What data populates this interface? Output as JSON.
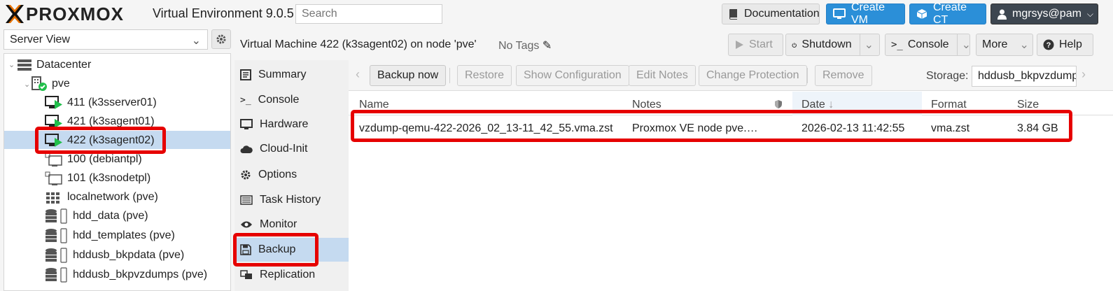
{
  "app": {
    "logo_text": "PROXMOX",
    "title": "Virtual Environment 9.0.5"
  },
  "search": {
    "placeholder": "Search"
  },
  "topbar": {
    "documentation": "Documentation",
    "create_vm": "Create VM",
    "create_ct": "Create CT",
    "user": "mgrsys@pam"
  },
  "server_view": {
    "selected": "Server View"
  },
  "tree": {
    "datacenter": "Datacenter",
    "node": "pve",
    "items": [
      {
        "label": "411 (k3sserver01)",
        "icon": "vm-running-icon"
      },
      {
        "label": "421 (k3sagent01)",
        "icon": "vm-running-icon"
      },
      {
        "label": "422 (k3sagent02)",
        "icon": "vm-running-icon"
      },
      {
        "label": "100 (debiantpl)",
        "icon": "template-icon"
      },
      {
        "label": "101 (k3snodetpl)",
        "icon": "template-icon"
      },
      {
        "label": "localnetwork (pve)",
        "icon": "network-icon"
      },
      {
        "label": "hdd_data (pve)",
        "icon": "storage-icon"
      },
      {
        "label": "hdd_templates (pve)",
        "icon": "storage-icon"
      },
      {
        "label": "hddusb_bkpdata (pve)",
        "icon": "storage-icon"
      },
      {
        "label": "hddusb_bkpvzdumps (pve)",
        "icon": "storage-icon"
      }
    ]
  },
  "header": {
    "title": "Virtual Machine 422 (k3sagent02) on node 'pve'",
    "tags": "No Tags",
    "start": "Start",
    "shutdown": "Shutdown",
    "console": "Console",
    "more": "More",
    "help": "Help"
  },
  "nav": {
    "items": [
      {
        "label": "Summary",
        "icon": "summary-icon"
      },
      {
        "label": "Console",
        "icon": "console-icon"
      },
      {
        "label": "Hardware",
        "icon": "monitor-icon"
      },
      {
        "label": "Cloud-Init",
        "icon": "cloud-icon"
      },
      {
        "label": "Options",
        "icon": "gear-icon"
      },
      {
        "label": "Task History",
        "icon": "list-icon"
      },
      {
        "label": "Monitor",
        "icon": "eye-icon"
      },
      {
        "label": "Backup",
        "icon": "floppy-icon"
      },
      {
        "label": "Replication",
        "icon": "replication-icon"
      }
    ],
    "selected": "Backup"
  },
  "toolbar": {
    "backup_now": "Backup now",
    "restore": "Restore",
    "show_config": "Show Configuration",
    "edit_notes": "Edit Notes",
    "change_protection": "Change Protection",
    "remove": "Remove",
    "storage_label": "Storage:",
    "storage_value": "hddusb_bkpvzdumps"
  },
  "table": {
    "columns": [
      "Name",
      "Notes",
      "Date",
      "Format",
      "Size"
    ],
    "rows": [
      {
        "name": "vzdump-qemu-422-2026_02_13-11_42_55.vma.zst",
        "notes": "Proxmox VE node pve.…",
        "date": "2026-02-13 11:42:55",
        "format": "vma.zst",
        "size": "3.84 GB"
      }
    ]
  },
  "colors": {
    "accent_blue": "#2b8fd8",
    "selection": "#c5daf0",
    "highlight_red": "#e60000",
    "logo_orange": "#e57000",
    "running_green": "#21bf4b"
  }
}
